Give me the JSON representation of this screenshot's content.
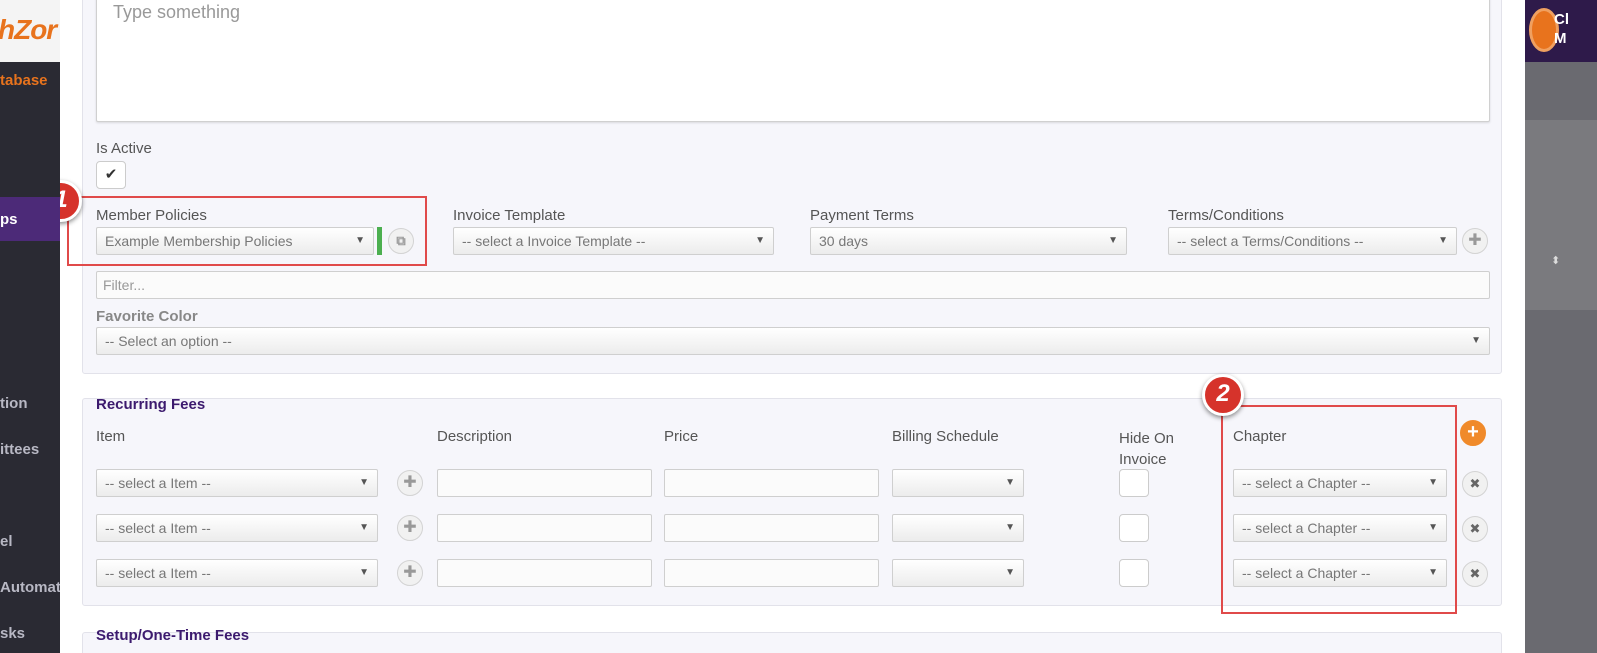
{
  "app": {
    "logo_text": "hZor",
    "sidebar": {
      "database": "tabase",
      "active": "ps",
      "item_tion": "tion",
      "item_ittees": "ittees",
      "item_el": "el",
      "item_autom": "Automat",
      "item_sks": "sks"
    },
    "user_lines": [
      "Cl",
      "M"
    ]
  },
  "form": {
    "description": {
      "placeholder": "Type something"
    },
    "is_active": {
      "label": "Is Active",
      "checked": true,
      "check_glyph": "✔"
    },
    "member_policies": {
      "label": "Member Policies",
      "value": "Example Membership Policies"
    },
    "invoice_template": {
      "label": "Invoice Template",
      "value": "-- select a Invoice Template --"
    },
    "payment_terms": {
      "label": "Payment Terms",
      "value": "30 days"
    },
    "terms_conditions": {
      "label": "Terms/Conditions",
      "value": "-- select a Terms/Conditions --"
    },
    "filter": {
      "placeholder": "Filter..."
    },
    "favorite_color": {
      "label": "Favorite Color",
      "value": "-- Select an option --"
    }
  },
  "recurring_fees": {
    "title": "Recurring Fees",
    "columns": {
      "item": "Item",
      "description": "Description",
      "price": "Price",
      "billing_schedule": "Billing Schedule",
      "hide_on_invoice_1": "Hide On",
      "hide_on_invoice_2": "Invoice",
      "chapter": "Chapter"
    },
    "rows": [
      {
        "item": "-- select a Item --",
        "description": "",
        "price": "",
        "billing_schedule": "",
        "hide_on_invoice": false,
        "chapter": "-- select a Chapter --"
      },
      {
        "item": "-- select a Item --",
        "description": "",
        "price": "",
        "billing_schedule": "",
        "hide_on_invoice": false,
        "chapter": "-- select a Chapter --"
      },
      {
        "item": "-- select a Item --",
        "description": "",
        "price": "",
        "billing_schedule": "",
        "hide_on_invoice": false,
        "chapter": "-- select a Chapter --"
      }
    ]
  },
  "setup_fees": {
    "title": "Setup/One-Time Fees"
  },
  "annotations": {
    "badge1": "1",
    "badge2": "2"
  },
  "icons": {
    "arrow": "▼",
    "plus": "✚",
    "add": "+",
    "remove": "✖",
    "edit": "⧉",
    "sort": "⬍"
  },
  "colors": {
    "accent_purple": "#3c1a6e",
    "accent_orange": "#e8731d",
    "annotation_red": "#e04a4a",
    "status_green": "#4caf50"
  }
}
